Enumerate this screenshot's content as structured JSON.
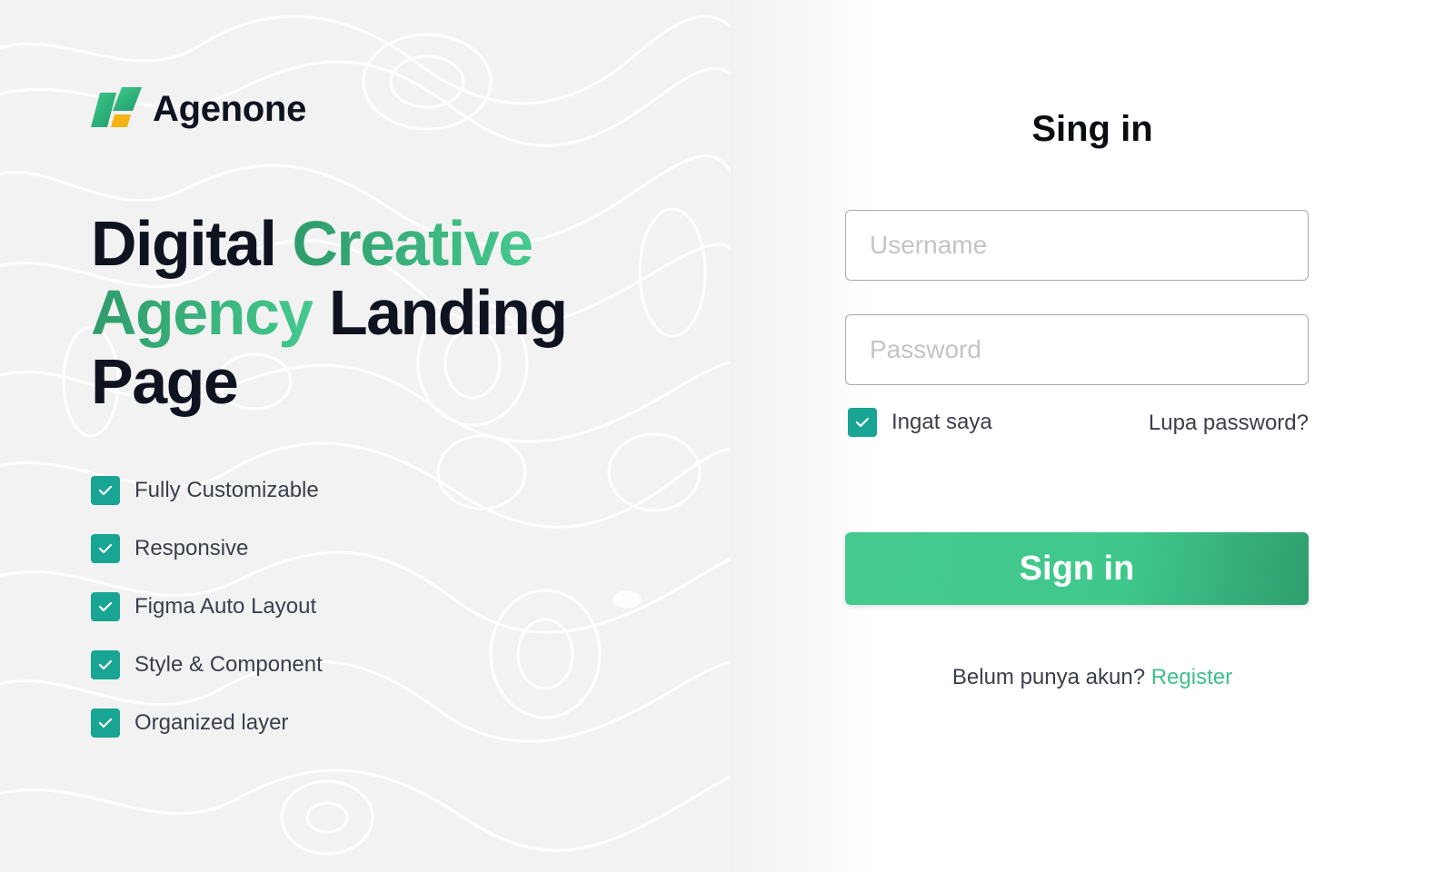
{
  "brand": {
    "name": "Agenone",
    "logo": "agenone-logo-mark"
  },
  "hero": {
    "line1_plain": "Digital",
    "line1_accent": "Creative",
    "line2_accent": "Agency",
    "line2_plain": "Landing",
    "line3_plain": "Page"
  },
  "features": [
    {
      "label": "Fully Customizable",
      "icon": "check-icon"
    },
    {
      "label": "Responsive",
      "icon": "check-icon"
    },
    {
      "label": "Figma Auto Layout",
      "icon": "check-icon"
    },
    {
      "label": "Style & Component",
      "icon": "check-icon"
    },
    {
      "label": "Organized layer",
      "icon": "check-icon"
    }
  ],
  "form": {
    "title": "Sing in",
    "username": {
      "value": "",
      "placeholder": "Username"
    },
    "password": {
      "value": "",
      "placeholder": "Password"
    },
    "remember": {
      "label": "Ingat saya",
      "checked": true
    },
    "forgot_label": "Lupa password?",
    "submit_label": "Sign in",
    "register_prompt": "Belum punya akun?",
    "register_link": "Register"
  },
  "colors": {
    "accent": "#40c88c",
    "accent_dark": "#2f9b6a",
    "checkbox": "#18a593",
    "heading": "#0f1320",
    "text": "#3a3f4b",
    "panel_bg": "#f2f2f2"
  }
}
